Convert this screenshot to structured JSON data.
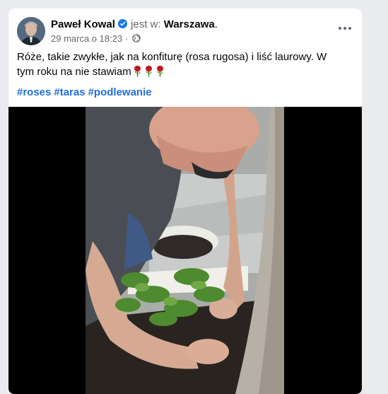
{
  "post": {
    "author": "Paweł Kowal",
    "verified": true,
    "location_prefix": "jest w:",
    "location": "Warszawa",
    "location_suffix": ".",
    "timestamp": "29 marca o 18:23",
    "separator": "·",
    "audience_icon": "globe-icon",
    "text": "Róże, takie zwykłe, jak na konfiturę (rosa rugosa) i liść laurowy. W tym roku na nie stawiam",
    "emoji": [
      "rose-icon",
      "rose-icon",
      "rose-icon"
    ],
    "hashtags": [
      "#roses",
      "#taras",
      "#podlewanie"
    ]
  },
  "menu_icon": "more-options-icon",
  "colors": {
    "link": "#216fdb",
    "verified": "#1877f2",
    "muted": "#65676b",
    "media_background": "#000000"
  }
}
